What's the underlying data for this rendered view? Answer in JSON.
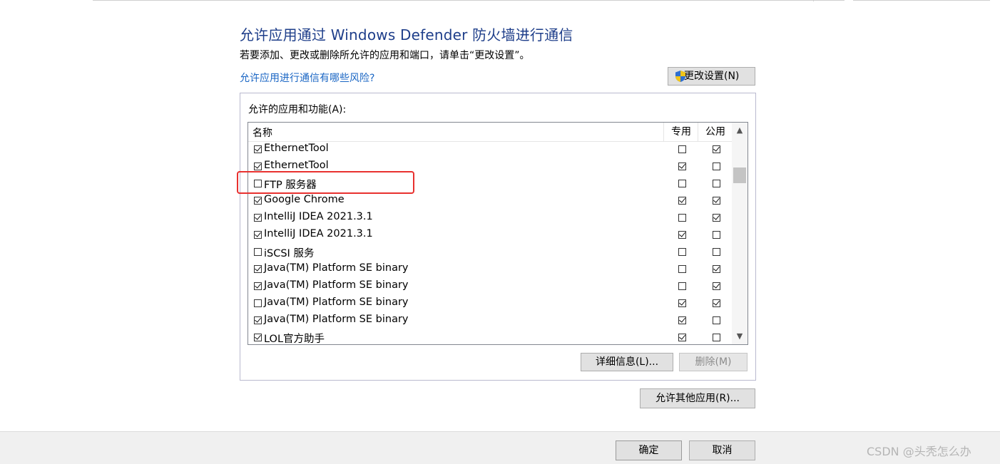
{
  "title": "允许应用通过 Windows Defender 防火墙进行通信",
  "subtitle": "若要添加、更改或删除所允许的应用和端口，请单击“更改设置”。",
  "risk_link": "允许应用进行通信有哪些风险?",
  "change_settings_label": "更改设置(N)",
  "group_label": "允许的应用和功能(A):",
  "columns": {
    "name": "名称",
    "private": "专用",
    "public": "公用"
  },
  "apps": [
    {
      "name": "EthernetTool",
      "enabled": true,
      "private": false,
      "public": true
    },
    {
      "name": "EthernetTool",
      "enabled": true,
      "private": true,
      "public": false
    },
    {
      "name": "FTP 服务器",
      "enabled": false,
      "private": false,
      "public": false
    },
    {
      "name": "Google Chrome",
      "enabled": true,
      "private": true,
      "public": true
    },
    {
      "name": "IntelliJ IDEA 2021.3.1",
      "enabled": true,
      "private": false,
      "public": true
    },
    {
      "name": "IntelliJ IDEA 2021.3.1",
      "enabled": true,
      "private": true,
      "public": false
    },
    {
      "name": "iSCSI 服务",
      "enabled": false,
      "private": false,
      "public": false
    },
    {
      "name": "Java(TM) Platform SE binary",
      "enabled": true,
      "private": false,
      "public": true
    },
    {
      "name": "Java(TM) Platform SE binary",
      "enabled": true,
      "private": false,
      "public": true
    },
    {
      "name": "Java(TM) Platform SE binary",
      "enabled": false,
      "private": true,
      "public": true
    },
    {
      "name": "Java(TM) Platform SE binary",
      "enabled": true,
      "private": true,
      "public": false
    },
    {
      "name": "LOL官方助手",
      "enabled": true,
      "private": true,
      "public": false
    }
  ],
  "buttons": {
    "details": "详细信息(L)...",
    "delete": "删除(M)",
    "allow_other": "允许其他应用(R)...",
    "ok": "确定",
    "cancel": "取消"
  },
  "watermark": "CSDN @头秃怎么办",
  "colors": {
    "title": "#1e3e8a",
    "link": "#1a66c4",
    "highlight": "#e8312f"
  },
  "icons": {
    "change_settings": "uac-shield-icon",
    "scroll_up": "chevron-up-icon",
    "scroll_down": "chevron-down-icon"
  }
}
